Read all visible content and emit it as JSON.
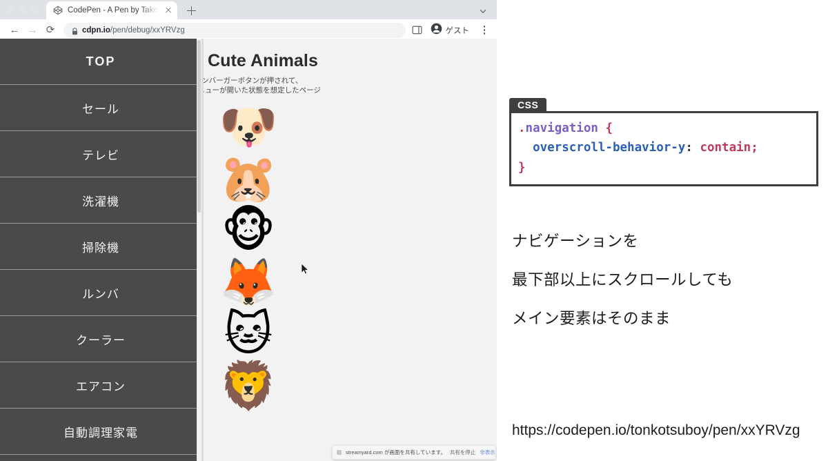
{
  "browser": {
    "window_controls": [
      "close",
      "minimize",
      "maximize"
    ],
    "tab": {
      "title": "CodePen - A Pen by Takeshi K",
      "favicon_name": "codepen-icon",
      "close_label": "×"
    },
    "new_tab_label": "+",
    "toolbar": {
      "back_label": "←",
      "forward_label": "→",
      "reload_label": "⟳",
      "url_domain": "cdpn.io",
      "url_path": "/pen/debug/xxYRVzg",
      "url_full": "cdpn.io/pen/debug/xxYRVzg",
      "lock_icon": "lock-icon",
      "sidepanel_icon": "side-panel-icon",
      "profile_name": "ゲスト",
      "menu_icon": "kebab-menu-icon"
    }
  },
  "page": {
    "title": "My Cute Animals",
    "subtitle_line1": "ハンバーガーボタンが押されて、",
    "subtitle_line2": "左側メニューが開いた状態を想定したページ",
    "animals": [
      "🐶",
      "🐹",
      "🐵",
      "🦊",
      "🐱",
      "🦁"
    ],
    "navigation": {
      "items": [
        {
          "label": "TOP"
        },
        {
          "label": "セール"
        },
        {
          "label": "テレビ"
        },
        {
          "label": "洗濯機"
        },
        {
          "label": "掃除機"
        },
        {
          "label": "ルンバ"
        },
        {
          "label": "クーラー"
        },
        {
          "label": "エアコン"
        },
        {
          "label": "自動調理家電"
        }
      ],
      "background_color": "#4a4a4a",
      "text_color": "#f2f2f2"
    }
  },
  "share_notification": {
    "message": "streamyard.com が画面を共有しています。",
    "stop_label": "共有を停止",
    "hide_label": "非表示",
    "hide_color": "#6b8fd4"
  },
  "slide": {
    "code": {
      "tab_label": "CSS",
      "line1_dot": ".",
      "line1_selector": "navigation",
      "line1_brace": "{",
      "line2_property": "overscroll-behavior-y",
      "line2_colon": ":",
      "line2_value": "contain",
      "line2_semicolon": ";",
      "line3_brace": "}",
      "colors": {
        "selector": "#7b5ec7",
        "property": "#2a5fb5",
        "value": "#c0395a",
        "punctuation": "#c0395a",
        "frame": "#3f3f3f"
      }
    },
    "caption_line1": "ナビゲーションを",
    "caption_line2": "最下部以上にスクロールしても",
    "caption_line3": "メイン要素はそのまま",
    "permalink": "https://codepen.io/tonkotsuboy/pen/xxYRVzg"
  }
}
